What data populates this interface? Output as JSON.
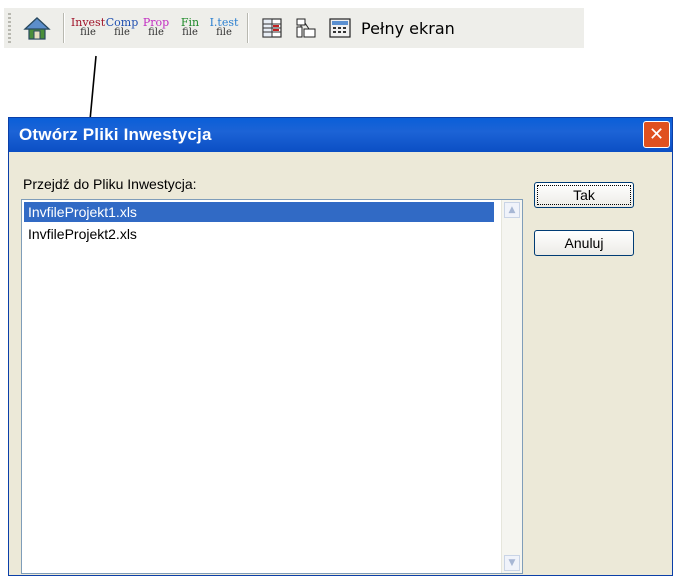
{
  "toolbar": {
    "buttons": [
      {
        "top": "Invest",
        "bottom": "file",
        "color": "#a0142a"
      },
      {
        "top": "Comp",
        "bottom": "file",
        "color": "#1f4fb0"
      },
      {
        "top": "Prop",
        "bottom": "file",
        "color": "#c22bc2"
      },
      {
        "top": "Fin",
        "bottom": "file",
        "color": "#1f8a2a"
      },
      {
        "top": "I.test",
        "bottom": "file",
        "color": "#2a7fd0"
      }
    ],
    "fullscreen_label": "Pełny ekran",
    "icons": [
      "home-icon",
      "grid-icon",
      "chart-icon",
      "calculator-icon"
    ]
  },
  "dialog": {
    "title": "Otwórz Pliki Inwestycja",
    "prompt": "Przejdź do Pliku Inwestycja:",
    "files": [
      "InvfileProjekt1.xls",
      "InvfileProjekt2.xls"
    ],
    "ok_label": "Tak",
    "cancel_label": "Anuluj",
    "close_glyph": "✕"
  }
}
